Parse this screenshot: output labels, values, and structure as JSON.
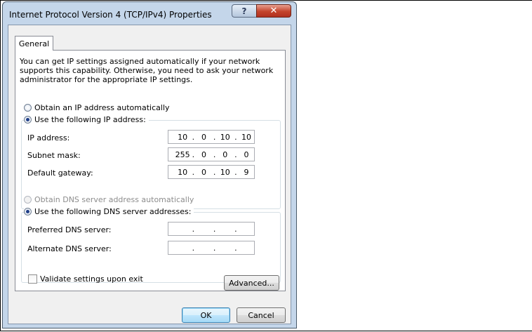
{
  "window": {
    "title": "Internet Protocol Version 4 (TCP/IPv4) Properties",
    "help_label": "?",
    "close_label": "✕"
  },
  "tabs": [
    {
      "label": "General",
      "selected": true
    }
  ],
  "description": "You can get IP settings assigned automatically if your network supports this capability. Otherwise, you need to ask your network administrator for the appropriate IP settings.",
  "ip_section": {
    "auto_label": "Obtain an IP address automatically",
    "manual_label": "Use the following IP address:",
    "selected": "manual",
    "fields": [
      {
        "label": "IP address:",
        "octets": [
          "10",
          "0",
          "10",
          "10"
        ]
      },
      {
        "label": "Subnet mask:",
        "octets": [
          "255",
          "0",
          "0",
          "0"
        ]
      },
      {
        "label": "Default gateway:",
        "octets": [
          "10",
          "0",
          "10",
          "9"
        ]
      }
    ]
  },
  "dns_section": {
    "auto_label": "Obtain DNS server address automatically",
    "manual_label": "Use the following DNS server addresses:",
    "selected": "manual",
    "fields": [
      {
        "label": "Preferred DNS server:",
        "octets": [
          "",
          "",
          "",
          ""
        ]
      },
      {
        "label": "Alternate DNS server:",
        "octets": [
          "",
          "",
          "",
          ""
        ]
      }
    ]
  },
  "validate": {
    "label": "Validate settings upon exit",
    "checked": false
  },
  "buttons": {
    "advanced": "Advanced...",
    "ok": "OK",
    "cancel": "Cancel"
  },
  "colors": {
    "title_bar": "#c4d6ea",
    "close_button": "#c4442c",
    "dialog_bg": "#f0f0f0",
    "radio_dot": "#1f3e88"
  }
}
